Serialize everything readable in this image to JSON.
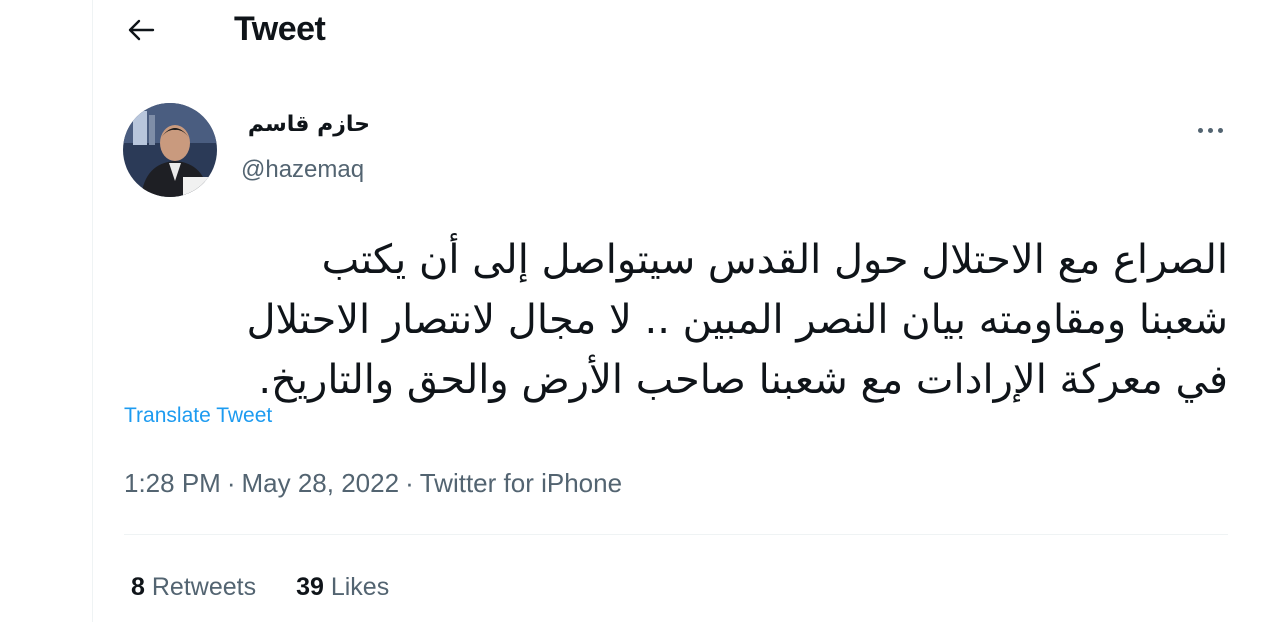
{
  "header": {
    "title": "Tweet"
  },
  "author": {
    "display_name": "حازم قاسم",
    "handle": "@hazemaq"
  },
  "tweet": {
    "lines": [
      "الصراع مع الاحتلال حول القدس سيتواصل إلى أن يكتب",
      "شعبنا ومقاومته بيان النصر المبين .. لا مجال لانتصار الاحتلال",
      "في معركة الإرادات مع شعبنا صاحب الأرض والحق والتاريخ."
    ],
    "translate_label": "Translate Tweet",
    "time": "1:28 PM",
    "date": "May 28, 2022",
    "source": "Twitter for iPhone",
    "separator": "·"
  },
  "stats": {
    "retweets_count": "8",
    "retweets_label": "Retweets",
    "likes_count": "39",
    "likes_label": "Likes"
  },
  "colors": {
    "link": "#1d9bf0",
    "muted": "#536471",
    "text": "#0f1419"
  }
}
